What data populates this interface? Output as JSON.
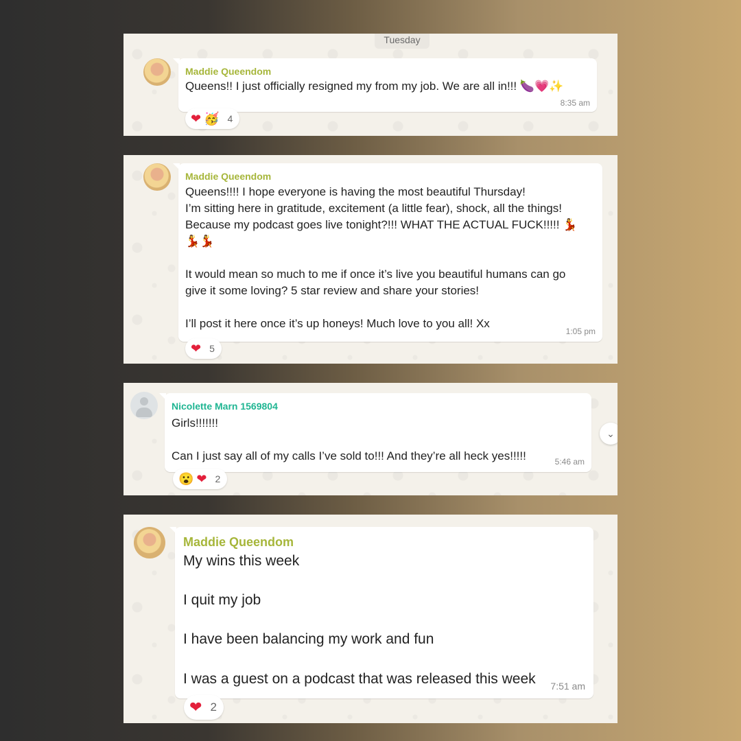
{
  "colors": {
    "sender_green": "#a6b63a",
    "sender_teal": "#1fb592",
    "heart_red": "#e3203b",
    "panel_bg": "#f4f1ea"
  },
  "date_divider": "Tuesday",
  "messages": [
    {
      "sender": "Maddie Queendom",
      "avatar": "profile-photo",
      "lines": [
        "Queens!! I just officially resigned my from my job. We are all in!!! 🍆💗✨"
      ],
      "time": "8:35 am",
      "reactions": {
        "icons": [
          "❤",
          "🥳"
        ],
        "count": "4"
      }
    },
    {
      "sender": "Maddie Queendom",
      "avatar": "profile-photo",
      "lines": [
        "Queens!!!! I hope everyone is having the most beautiful Thursday!",
        "I’m sitting here in gratitude, excitement (a little fear), shock, all the things!",
        "Because my podcast goes live tonight?!!! WHAT THE ACTUAL FUCK!!!!! 💃",
        "💃💃",
        "",
        "It would mean so much to me if once it’s live you beautiful humans can go",
        "give it some loving? 5 star review and share your stories!",
        "",
        "I’ll post it here once it’s up honeys! Much love to you all! Xx"
      ],
      "time": "1:05 pm",
      "reactions": {
        "icons": [
          "❤"
        ],
        "count": "5"
      }
    },
    {
      "sender": "Nicolette Marn 1569804",
      "avatar": "default-avatar",
      "lines": [
        "Girls!!!!!!!",
        "",
        "Can I just say all of my calls I’ve sold to!!! And they’re all heck yes!!!!!"
      ],
      "time": "5:46 am",
      "reactions": {
        "icons": [
          "😮",
          "❤"
        ],
        "count": "2"
      }
    },
    {
      "sender": "Maddie Queendom",
      "avatar": "profile-photo",
      "lines": [
        "My wins this week",
        "",
        "I quit my job",
        "",
        "I have been balancing my work and fun",
        "",
        "I was a guest on a podcast that was released this week"
      ],
      "time": "7:51 am",
      "reactions": {
        "icons": [
          "❤"
        ],
        "count": "2"
      }
    }
  ],
  "scroll_button_icon": "chevron-down-icon"
}
